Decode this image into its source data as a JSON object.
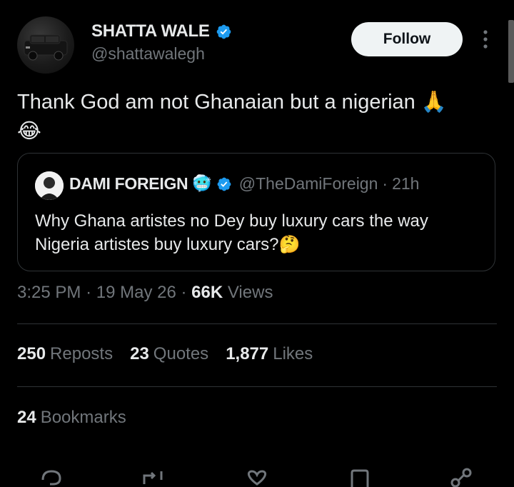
{
  "author": {
    "name": "SHATTA WALE",
    "handle": "@shattawalegh",
    "follow_label": "Follow"
  },
  "tweet": {
    "text": "Thank God am not Ghanaian but a nigerian",
    "emoji_pray": "🙏",
    "emoji_laugh": "😂"
  },
  "quoted": {
    "name": "DAMI FOREIGN",
    "name_emoji": "🥶",
    "handle": "@TheDamiForeign",
    "separator": "·",
    "time": "21h",
    "text": "Why Ghana artistes no Dey buy luxury cars the way Nigeria artistes buy luxury cars?",
    "text_emoji": "🤔"
  },
  "meta": {
    "time": "3:25 PM",
    "sep1": "·",
    "date": "19 May 26",
    "sep2": "·",
    "views_count": "66K",
    "views_label": "Views"
  },
  "stats": {
    "reposts_count": "250",
    "reposts_label": "Reposts",
    "quotes_count": "23",
    "quotes_label": "Quotes",
    "likes_count": "1,877",
    "likes_label": "Likes",
    "bookmarks_count": "24",
    "bookmarks_label": "Bookmarks"
  },
  "icons": {
    "verified": "verified-badge-icon",
    "more": "more-vertical-icon",
    "reply": "reply-icon",
    "repost": "repost-icon",
    "like": "heart-icon",
    "bookmark": "bookmark-icon",
    "share": "share-icon"
  },
  "colors": {
    "background": "#000000",
    "text": "#e7e9ea",
    "muted": "#71767b",
    "verified": "#1d9bf0",
    "border": "#2f3336"
  }
}
